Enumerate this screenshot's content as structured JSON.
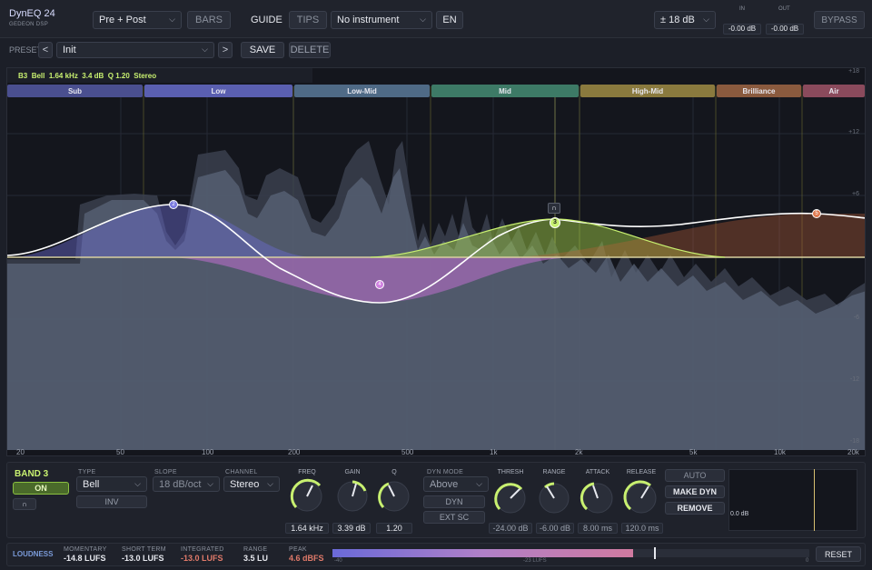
{
  "header": {
    "app_title": "DynEQ 24",
    "vendor": "GEDEON DSP",
    "mode_select": "Pre + Post",
    "bars": "BARS",
    "guide": "GUIDE",
    "tips": "TIPS",
    "instrument": "No instrument",
    "lang": "EN",
    "range": "± 18 dB",
    "in_label": "IN",
    "out_label": "OUT",
    "in_value": "-0.00 dB",
    "out_value": "-0.00 dB",
    "bypass": "BYPASS"
  },
  "preset": {
    "label": "PRESET",
    "prev": "<",
    "next": ">",
    "name": "Init",
    "save": "SAVE",
    "delete": "DELETE"
  },
  "band_info": {
    "band": "B3",
    "type": "Bell",
    "freq": "1.64 kHz",
    "gain": "3.4 dB",
    "q": "Q 1.20",
    "mode": "Stereo"
  },
  "bands": [
    "Sub",
    "Low",
    "Low-Mid",
    "Mid",
    "High-Mid",
    "Brilliance",
    "Air"
  ],
  "db_scale": [
    "+18",
    "+12",
    "+6",
    "-6",
    "-12",
    "-18"
  ],
  "freq_scale": [
    "20",
    "50",
    "100",
    "200",
    "500",
    "1k",
    "2k",
    "5k",
    "10k",
    "20k"
  ],
  "nodes": [
    "1",
    "2",
    "3",
    "4",
    "5"
  ],
  "controls": {
    "band_title": "BAND 3",
    "on": "ON",
    "type_label": "TYPE",
    "type": "Bell",
    "inv": "INV",
    "slope_label": "SLOPE",
    "slope": "18 dB/oct",
    "channel_label": "CHANNEL",
    "channel": "Stereo",
    "freq_label": "FREQ",
    "freq": "1.64 kHz",
    "gain_label": "GAIN",
    "gain": "3.39 dB",
    "q_label": "Q",
    "q": "1.20",
    "dyn_mode_label": "DYN MODE",
    "dyn_mode": "Above",
    "dyn": "DYN",
    "ext_sc": "EXT SC",
    "thresh_label": "THRESH",
    "thresh": "-24.00 dB",
    "range_label": "RANGE",
    "range": "-6.00 dB",
    "attack_label": "ATTACK",
    "attack": "8.00 ms",
    "release_label": "RELEASE",
    "release": "120.0 ms",
    "auto": "AUTO",
    "make_dyn": "MAKE DYN",
    "remove": "REMOVE",
    "gr_value": "0.0 dB"
  },
  "loudness": {
    "title": "LOUDNESS",
    "momentary_label": "MOMENTARY",
    "momentary": "-14.8 LUFS",
    "short_label": "SHORT TERM",
    "short": "-13.0 LUFS",
    "integrated_label": "INTEGRATED",
    "integrated": "-13.0 LUFS",
    "range_label": "RANGE",
    "range": "3.5 LU",
    "peak_label": "PEAK",
    "peak": "4.6 dBFS",
    "scale_min": "-40",
    "scale_target": "-23 LUFS",
    "scale_max": "0",
    "reset": "RESET"
  },
  "colors": {
    "accent": "#b9e36b",
    "band_sub": "#4a4f8f",
    "band_low": "#5a5fb0",
    "band_lowmid": "#4f6a86",
    "band_mid": "#3d7a66",
    "band_highmid": "#8a7a3e",
    "band_brill": "#8a5a3e",
    "band_air": "#8a4a5c"
  }
}
